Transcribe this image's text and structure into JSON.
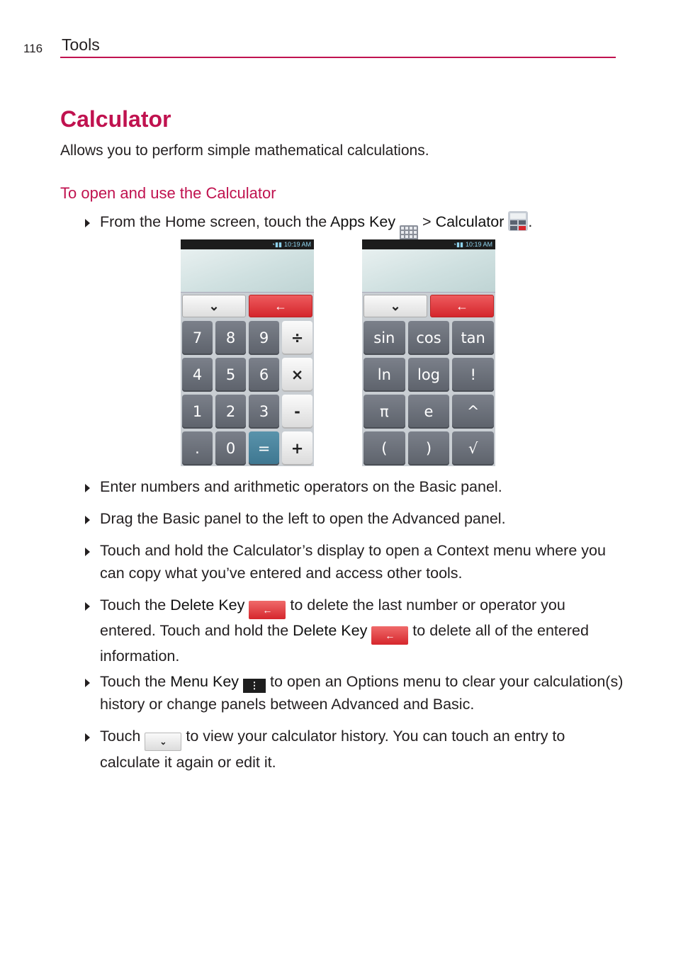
{
  "header": {
    "page_number": "116",
    "section": "Tools"
  },
  "title": "Calculator",
  "intro": "Allows you to perform simple mathematical calculations.",
  "subheading": "To open and use the Calculator",
  "step1": {
    "pre": "From the Home screen, touch the ",
    "apps_key": "Apps Key",
    "sep": " > ",
    "calculator": "Calculator",
    "end": "."
  },
  "phones": {
    "status_time": "10:19 AM",
    "history_key": "⌄",
    "delete_key": "←",
    "basic_keys": [
      "7",
      "8",
      "9",
      "÷",
      "4",
      "5",
      "6",
      "×",
      "1",
      "2",
      "3",
      "-",
      ".",
      "0",
      "=",
      "+"
    ],
    "advanced_keys": [
      "sin",
      "cos",
      "tan",
      "ln",
      "log",
      "!",
      "π",
      "e",
      "^",
      "(",
      ")",
      "√"
    ]
  },
  "bullets": {
    "b1": "Enter numbers and arithmetic operators on the Basic panel.",
    "b2": "Drag the Basic panel to the left to open the Advanced panel.",
    "b3": "Touch and hold the Calculator’s display to open a Context menu where you can copy what you’ve entered and access other tools.",
    "b4": {
      "pre": "Touch the ",
      "key": "Delete Key",
      "mid": " to delete the last number or operator you entered. Touch and hold the ",
      "key2": "Delete Key",
      "end": " to delete all of the entered information."
    },
    "b5": {
      "pre": "Touch the ",
      "key": "Menu Key",
      "end": " to open an Options menu to clear your calculation(s) history or change panels between Advanced and Basic."
    },
    "b6": {
      "pre": "Touch ",
      "end": " to view your calculator history. You can touch an entry to calculate it again or edit it."
    }
  },
  "icons": {
    "delete_glyph": "←",
    "menu_glyph": "⋮",
    "history_glyph": "⌄"
  },
  "colors": {
    "accent": "#c0124f",
    "delete_red": "#d6262c",
    "equals_blue": "#3d7690"
  }
}
